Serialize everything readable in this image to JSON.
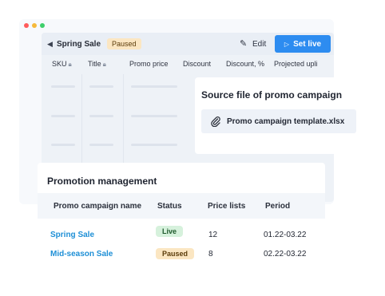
{
  "app": {
    "campaign_title": "Spring Sale",
    "status_chip": "Paused",
    "edit_label": "Edit",
    "set_live_label": "Set live",
    "columns": [
      {
        "label": "SKU",
        "locked": true
      },
      {
        "label": "Title",
        "locked": true
      },
      {
        "label": "Promo price",
        "locked": false
      },
      {
        "label": "Discount",
        "locked": false
      },
      {
        "label": "Discount, %",
        "locked": false
      },
      {
        "label": "Projected upli",
        "locked": false
      }
    ]
  },
  "source_file": {
    "title": "Source file of promo campaign",
    "file_name": "Promo campaign template.xlsx"
  },
  "promotion": {
    "title": "Promotion management",
    "headers": [
      "Promo campaign name",
      "Status",
      "Price lists",
      "Period"
    ],
    "rows": [
      {
        "name": "Spring Sale",
        "status": "Live",
        "status_kind": "live",
        "price_lists": "12",
        "period": "01.22-03.22"
      },
      {
        "name": "Mid-season Sale",
        "status": "Paused",
        "status_kind": "paused",
        "price_lists": "8",
        "period": "02.22-03.22"
      }
    ]
  },
  "colors": {
    "accent": "#2d8cf0",
    "link": "#1e8fd6",
    "live_badge": "#d6f1dc",
    "paused_badge": "#fbe6c2"
  },
  "icons": {
    "back": "chevron-left-icon",
    "edit": "pencil-icon",
    "set_live": "play-icon",
    "lock": "lock-icon",
    "attachment": "paperclip-icon"
  }
}
